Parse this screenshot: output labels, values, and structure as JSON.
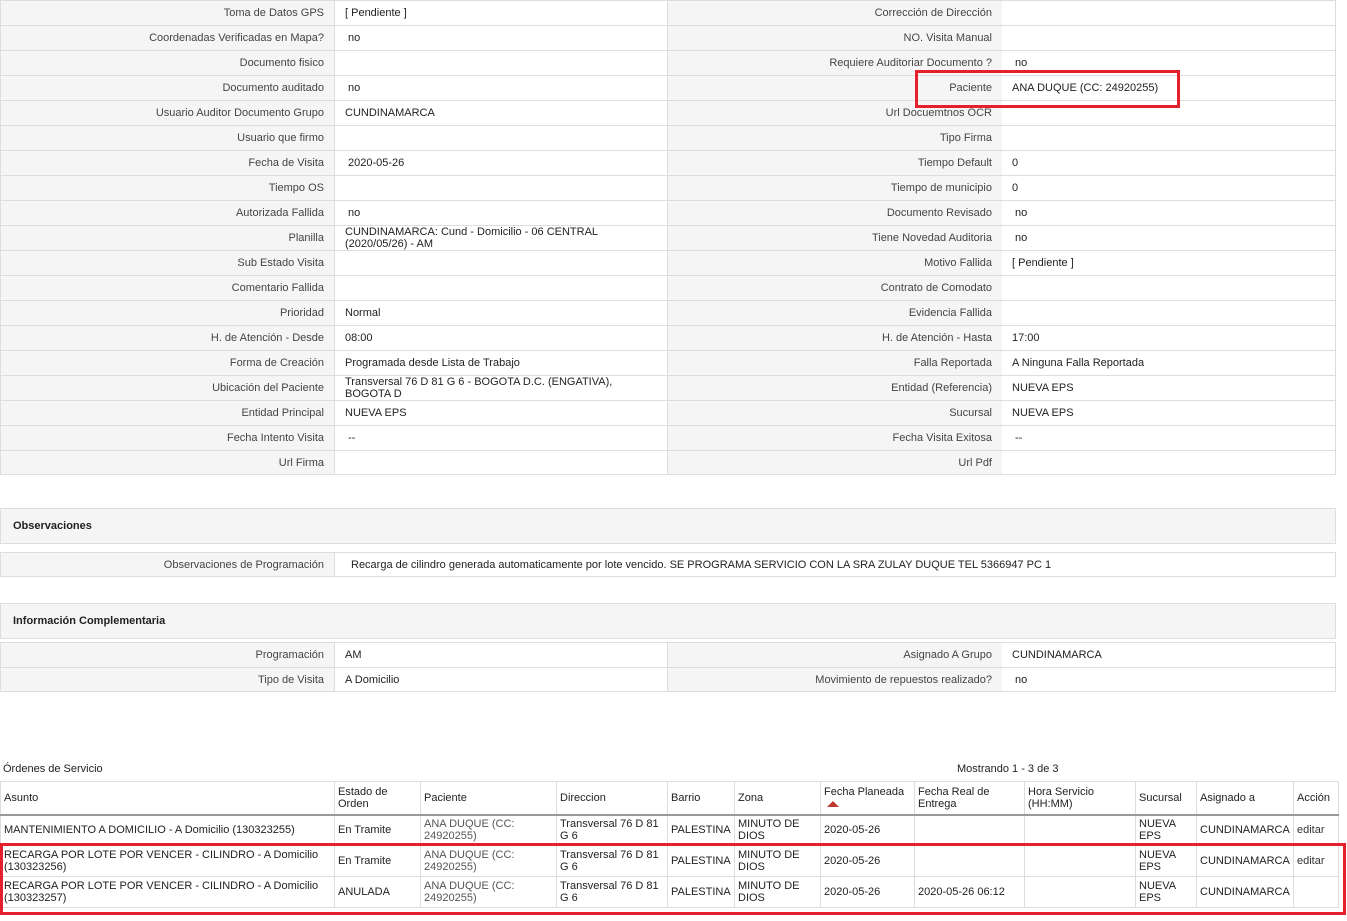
{
  "detail_rows": [
    {
      "l1": "Toma de Datos GPS",
      "v1": "[ Pendiente ]",
      "l2": "Corrección de Dirección",
      "v2": ""
    },
    {
      "l1": "Coordenadas Verificadas en Mapa?",
      "v1": "no",
      "l2": "NO. Visita Manual",
      "v2": ""
    },
    {
      "l1": "Documento fisico",
      "v1": "",
      "l2": "Requiere Auditoriar Documento ?",
      "v2": "no"
    },
    {
      "l1": "Documento auditado",
      "v1": "no",
      "l2": "Paciente",
      "v2": "ANA DUQUE (CC: 24920255)"
    },
    {
      "l1": "Usuario Auditor Documento Grupo",
      "v1": "CUNDINAMARCA",
      "l2": "Url Docuemtnos OCR",
      "v2": ""
    },
    {
      "l1": "Usuario que firmo",
      "v1": "",
      "l2": "Tipo Firma",
      "v2": ""
    },
    {
      "l1": "Fecha de Visita",
      "v1": "2020-05-26",
      "l2": "Tiempo Default",
      "v2": "0"
    },
    {
      "l1": "Tiempo OS",
      "v1": "",
      "l2": "Tiempo de municipio",
      "v2": "0"
    },
    {
      "l1": "Autorizada Fallida",
      "v1": "no",
      "l2": "Documento Revisado",
      "v2": "no"
    },
    {
      "l1": "Planilla",
      "v1": "CUNDINAMARCA: Cund - Domicilio - 06 CENTRAL (2020/05/26) - AM",
      "l2": "Tiene Novedad Auditoria",
      "v2": "no"
    },
    {
      "l1": "Sub Estado Visita",
      "v1": "",
      "l2": "Motivo Fallida",
      "v2": "[ Pendiente ]"
    },
    {
      "l1": "Comentario Fallida",
      "v1": "",
      "l2": "Contrato de Comodato",
      "v2": ""
    },
    {
      "l1": "Prioridad",
      "v1": "Normal",
      "l2": "Evidencia Fallida",
      "v2": ""
    },
    {
      "l1": "H. de Atención - Desde",
      "v1": "08:00",
      "l2": "H. de Atención - Hasta",
      "v2": "17:00"
    },
    {
      "l1": "Forma de Creación",
      "v1": "Programada desde Lista de Trabajo",
      "l2": "Falla Reportada",
      "v2": "A Ninguna Falla Reportada"
    },
    {
      "l1": "Ubicación del Paciente",
      "v1": "Transversal 76 D 81 G 6 - BOGOTA D.C. (ENGATIVA), BOGOTA D",
      "l2": "Entidad (Referencia)",
      "v2": "NUEVA EPS"
    },
    {
      "l1": "Entidad Principal",
      "v1": "NUEVA EPS",
      "l2": "Sucursal",
      "v2": "NUEVA EPS"
    },
    {
      "l1": "Fecha Intento Visita",
      "v1": "--",
      "l2": "Fecha Visita Exitosa",
      "v2": "--"
    },
    {
      "l1": "Url Firma",
      "v1": "",
      "l2": "Url Pdf",
      "v2": ""
    }
  ],
  "observaciones": {
    "title": "Observaciones",
    "label": "Observaciones de Programación",
    "value": "Recarga de cilindro generada automaticamente por lote vencido. SE PROGRAMA SERVICIO CON LA SRA ZULAY DUQUE TEL 5366947 PC 1"
  },
  "complementaria": {
    "title": "Información Complementaria",
    "rows": [
      {
        "l1": "Programación",
        "v1": "AM",
        "l2": "Asignado A Grupo",
        "v2": "CUNDINAMARCA"
      },
      {
        "l1": "Tipo de Visita",
        "v1": "A Domicilio",
        "l2": "Movimiento de repuestos realizado?",
        "v2": "no"
      }
    ]
  },
  "orders": {
    "title": "Órdenes de Servicio",
    "count_text": "Mostrando 1 - 3 de 3",
    "headers": [
      "Asunto",
      "Estado de Orden",
      "Paciente",
      "Direccion",
      "Barrio",
      "Zona",
      "Fecha Planeada",
      "Fecha Real de Entrega",
      "Hora Servicio (HH:MM)",
      "Sucursal",
      "Asignado a",
      "Acción"
    ],
    "rows": [
      [
        "MANTENIMIENTO A DOMICILIO - A Domicilio (130323255)",
        "En Tramite",
        "ANA DUQUE (CC: 24920255)",
        "Transversal 76 D 81 G 6",
        "PALESTINA",
        "MINUTO DE DIOS",
        "2020-05-26",
        "",
        "",
        "NUEVA EPS",
        "CUNDINAMARCA",
        "editar"
      ],
      [
        "RECARGA POR LOTE POR VENCER - CILINDRO - A Domicilio (130323256)",
        "En Tramite",
        "ANA DUQUE (CC: 24920255)",
        "Transversal 76 D 81 G 6",
        "PALESTINA",
        "MINUTO DE DIOS",
        "2020-05-26",
        "",
        "",
        "NUEVA EPS",
        "CUNDINAMARCA",
        "editar"
      ],
      [
        "RECARGA POR LOTE POR VENCER - CILINDRO - A Domicilio (130323257)",
        "ANULADA",
        "ANA DUQUE (CC: 24920255)",
        "Transversal 76 D 81 G 6",
        "PALESTINA",
        "MINUTO DE DIOS",
        "2020-05-26",
        "2020-05-26 06:12",
        "",
        "NUEVA EPS",
        "CUNDINAMARCA",
        ""
      ]
    ]
  },
  "colors": {
    "highlight": "#e3202c",
    "sort_icon": "#c0392b"
  }
}
